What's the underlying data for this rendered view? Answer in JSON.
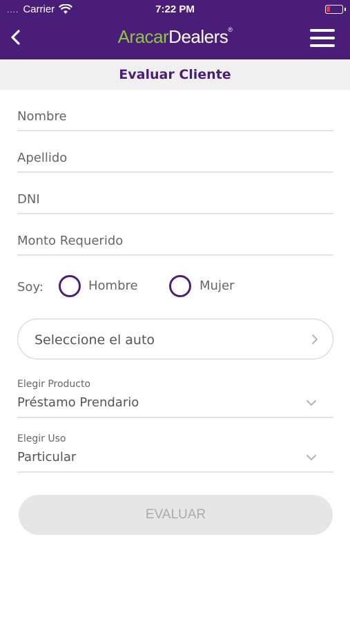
{
  "status_bar": {
    "signal": "....",
    "carrier": "Carrier",
    "time": "7:22 PM"
  },
  "header": {
    "logo_part1": "Aracar",
    "logo_part2": "Dealers",
    "logo_mark": "®",
    "brand_color": "#4a1e78",
    "logo_accent_color": "#8dc63f"
  },
  "page": {
    "title": "Evaluar Cliente"
  },
  "form": {
    "nombre_placeholder": "Nombre",
    "apellido_placeholder": "Apellido",
    "dni_placeholder": "DNI",
    "monto_placeholder": "Monto Requerido",
    "gender_label": "Soy:",
    "gender_options": [
      "Hombre",
      "Mujer"
    ],
    "auto_select_label": "Seleccione el auto",
    "producto": {
      "caption": "Elegir Producto",
      "value": "Préstamo Prendario"
    },
    "uso": {
      "caption": "Elegir Uso",
      "value": "Particular"
    },
    "submit_label": "EVALUAR"
  }
}
